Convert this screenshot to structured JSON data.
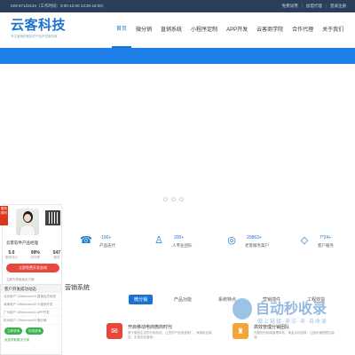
{
  "topbar": {
    "phone": "023-67122134（工作时间：9:00-12:00 13:30-18:00）",
    "free_trial": "免费试用",
    "join_agent": "加盟代理",
    "register_login": "登录注册"
  },
  "header": {
    "logo_name": "云客科技",
    "logo_slogan": "专注营销获客软件产品开发服务商",
    "nav": [
      "首页",
      "微分销",
      "直销系统",
      "小程序定制",
      "APP开发",
      "云客商学院",
      "合作代理",
      "关于我们"
    ]
  },
  "profile": {
    "badge": "服务顾问",
    "name": "云客软件产品经理",
    "stats": [
      {
        "num": "5.0",
        "label": "服务评分"
      },
      {
        "num": "99%",
        "label": "好评率"
      },
      {
        "num": "547",
        "label": "服务"
      }
    ],
    "call_button": "立即免费开发咨询",
    "note": "立即为您免费出方案"
  },
  "counters": [
    {
      "icon": "phone-icon",
      "glyph": "☎",
      "value": "100+",
      "label": "产品迭代"
    },
    {
      "icon": "user-icon",
      "glyph": "♙",
      "value": "200+",
      "label": "人专业团队"
    },
    {
      "icon": "globe-icon",
      "glyph": "◎",
      "value": "20863+",
      "label": "老客服务案户"
    },
    {
      "icon": "cube-icon",
      "glyph": "◇",
      "value": "7*24+",
      "label": "客户服务"
    }
  ],
  "dev_panel": {
    "title": "客户开发成功动态",
    "rows": [
      "北京用户 133xxxxxxx24 直销会员系统",
      "深圳用户 135xxxxxxx32 小程序开发",
      "广州用户 155xxxxxxx41 APP开发",
      "杭州用户 139xxxxxxx09 微分销"
    ],
    "btn_a": "立即咨询",
    "btn_b": "在线咨询",
    "green_note": "免费获取解决方案"
  },
  "section": {
    "title": "营销系统",
    "tabs": [
      "微分销",
      "产品功能",
      "系统特点",
      "营销插件",
      "工程效益"
    ]
  },
  "cards": [
    {
      "title": "开启移动电商微商时代",
      "desc": "基于微信生态的分销系统，让您的产品快速推广，海量粉丝裂变，实现全民营销。"
    },
    {
      "title": "高效管理分销团队",
      "desc": "完善的分销商管理体系，佣金自动结算，让团队管理更加高效。"
    }
  ],
  "watermark": {
    "big": "自动秒收录",
    "small": "做上链接·来访·来·自收录"
  },
  "colors": {
    "primary": "#1b73d1",
    "topbar": "#2b3f5c",
    "hero_band": "#1e7fe8",
    "accent_red": "#e8473b",
    "accent_green": "#35b34a"
  }
}
